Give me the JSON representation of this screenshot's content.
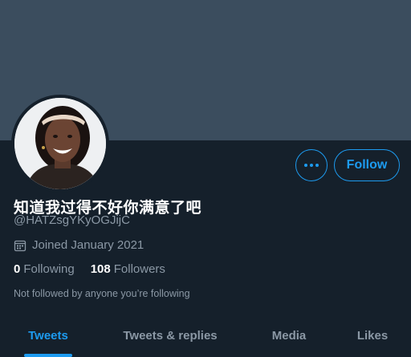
{
  "profile": {
    "display_name": "知道我过得不好你满意了吧",
    "handle": "@HATZsgYKyOGJijC",
    "joined": "Joined January 2021",
    "following_count": "0",
    "following_label": "Following",
    "followers_count": "108",
    "followers_label": "Followers",
    "not_followed_text": "Not followed by anyone you’re following"
  },
  "actions": {
    "follow_label": "Follow",
    "more_icon": "more-horizontal-icon"
  },
  "tabs": [
    {
      "label": "Tweets",
      "active": true
    },
    {
      "label": "Tweets & replies",
      "active": false
    },
    {
      "label": "Media",
      "active": false
    },
    {
      "label": "Likes",
      "active": false
    }
  ],
  "icons": {
    "calendar": "calendar-icon"
  },
  "colors": {
    "accent": "#1d9bf0",
    "background": "#15202b",
    "banner": "#3b4d5e",
    "secondary_text": "#8b98a5"
  }
}
